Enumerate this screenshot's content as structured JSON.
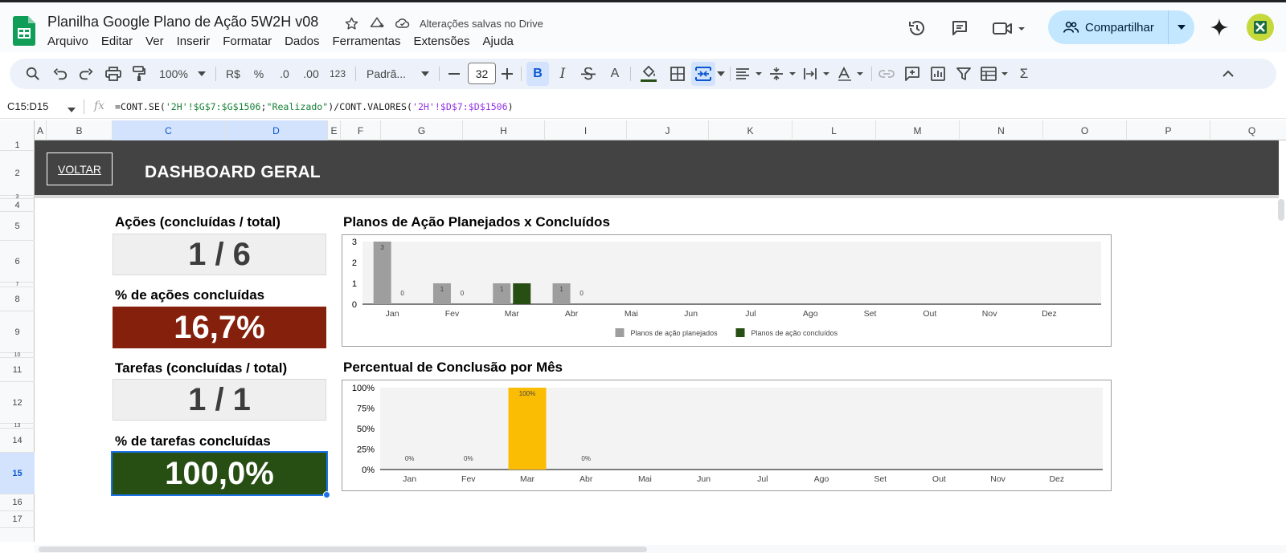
{
  "app": {
    "doc_title": "Planilha Google Plano de Ação 5W2H v08",
    "save_status": "Alterações salvas no Drive",
    "menu": [
      "Arquivo",
      "Editar",
      "Ver",
      "Inserir",
      "Formatar",
      "Dados",
      "Ferramentas",
      "Extensões",
      "Ajuda"
    ],
    "share_label": "Compartilhar"
  },
  "toolbar": {
    "zoom": "100%",
    "currency": "R$",
    "percent": "%",
    "dec_decrease": ".0",
    "dec_increase": ".00",
    "number_format": "123",
    "font_name": "Padrã...",
    "font_size": "32",
    "bold": "B",
    "italic": "I",
    "text_color": "A"
  },
  "formula_bar": {
    "name_box": "C15:D15",
    "fx": "fx",
    "parts": [
      {
        "t": "=CONT.SE(",
        "k": "plain"
      },
      {
        "t": "'2H'!$G$7:$G$1506",
        "k": "str"
      },
      {
        "t": ";",
        "k": "plain"
      },
      {
        "t": "\"Realizado\"",
        "k": "str"
      },
      {
        "t": ")/CONT.VALORES(",
        "k": "plain"
      },
      {
        "t": "'2H'!$D$7:$D$1506",
        "k": "ref"
      },
      {
        "t": ")",
        "k": "plain"
      }
    ]
  },
  "grid": {
    "columns": [
      "A",
      "B",
      "C",
      "D",
      "E",
      "F",
      "G",
      "H",
      "I",
      "J",
      "K",
      "L",
      "M",
      "N",
      "O",
      "P",
      "Q"
    ],
    "selected_columns": [
      "C",
      "D"
    ],
    "rows": [
      "1",
      "2",
      "3",
      "4",
      "5",
      "6",
      "7",
      "8",
      "9",
      "10",
      "11",
      "12",
      "13",
      "14",
      "15",
      "16",
      "17"
    ],
    "selected_row": "15"
  },
  "dashboard": {
    "back_button": "VOLTAR",
    "title": "DASHBOARD GERAL",
    "kpis": [
      {
        "label": "Ações (concluídas / total)",
        "value": "1 / 6",
        "style": "grey"
      },
      {
        "label": "% de ações concluídas",
        "value": "16,7%",
        "style": "red"
      },
      {
        "label": "Tarefas (concluídas / total)",
        "value": "1 / 1",
        "style": "grey"
      },
      {
        "label": "% de tarefas concluídas",
        "value": "100,0%",
        "style": "green"
      }
    ],
    "colors": {
      "banner": "#434343",
      "kpi_red": "#85200c",
      "kpi_green": "#274e13",
      "planned": "#9e9e9e",
      "done": "#274e13",
      "percent_bar": "#fbbc04"
    }
  },
  "chart_data": [
    {
      "type": "bar",
      "title": "Planos de Ação Planejados x Concluídos",
      "categories": [
        "Jan",
        "Fev",
        "Mar",
        "Abr",
        "Mai",
        "Jun",
        "Jul",
        "Ago",
        "Set",
        "Out",
        "Nov",
        "Dez"
      ],
      "series": [
        {
          "name": "Planos de ação planejados",
          "values": [
            3,
            1,
            1,
            1,
            null,
            null,
            null,
            null,
            null,
            null,
            null,
            null
          ],
          "labels": [
            "3",
            "1",
            "1",
            "1",
            "",
            "",
            "",
            "",
            "",
            "",
            "",
            ""
          ]
        },
        {
          "name": "Planos de ação concluídos",
          "values": [
            0,
            0,
            1,
            0,
            null,
            null,
            null,
            null,
            null,
            null,
            null,
            null
          ],
          "labels": [
            "0",
            "0",
            "",
            "0",
            "",
            "",
            "",
            "",
            "",
            "",
            "",
            ""
          ]
        }
      ],
      "ylim": [
        0,
        3
      ],
      "yticks": [
        "0",
        "1",
        "2",
        "3"
      ],
      "legend": "bottom",
      "grid": false
    },
    {
      "type": "bar",
      "title": "Percentual de Conclusão por Mês",
      "categories": [
        "Jan",
        "Fev",
        "Mar",
        "Abr",
        "Mai",
        "Jun",
        "Jul",
        "Ago",
        "Set",
        "Out",
        "Nov",
        "Dez"
      ],
      "series": [
        {
          "values": [
            0,
            0,
            100,
            0,
            null,
            null,
            null,
            null,
            null,
            null,
            null,
            null
          ],
          "labels": [
            "0%",
            "0%",
            "100%",
            "0%",
            "",
            "",
            "",
            "",
            "",
            "",
            "",
            ""
          ]
        }
      ],
      "ylim": [
        0,
        100
      ],
      "yticks": [
        "0%",
        "25%",
        "50%",
        "75%",
        "100%"
      ],
      "legend": "none",
      "grid": false
    }
  ]
}
